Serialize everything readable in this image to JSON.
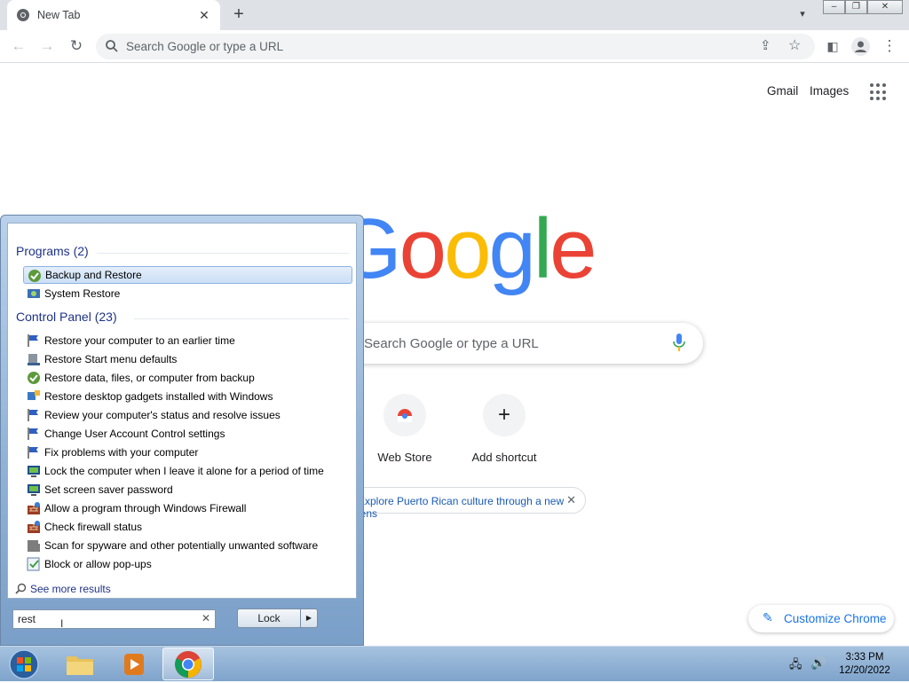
{
  "browser": {
    "tab_title": "New Tab",
    "omnibox_placeholder": "Search Google or type a URL"
  },
  "ntp": {
    "gmail": "Gmail",
    "images": "Images",
    "logo_letters": [
      "G",
      "o",
      "o",
      "g",
      "l",
      "e"
    ],
    "logo_colors": [
      "#4285f4",
      "#ea4335",
      "#fbbc05",
      "#4285f4",
      "#34a853",
      "#ea4335"
    ],
    "search_placeholder": "Search Google or type a URL",
    "shortcuts": [
      {
        "label": "Web Store",
        "icon": "web-store-icon"
      },
      {
        "label": "Add shortcut",
        "icon": "plus-icon",
        "glyph": "+"
      }
    ],
    "promo_chip": "Explore Puerto Rican culture through a new lens",
    "customize": "Customize Chrome"
  },
  "start_menu": {
    "programs_heading": "Programs (2)",
    "programs": [
      {
        "label": "Backup and Restore",
        "icon": "backup-restore-icon",
        "selected": true
      },
      {
        "label": "System Restore",
        "icon": "system-restore-icon"
      }
    ],
    "control_panel_heading": "Control Panel (23)",
    "control_panel": [
      {
        "label": "Restore your computer to an earlier time",
        "icon": "action-center-flag-icon"
      },
      {
        "label": "Restore Start menu defaults",
        "icon": "taskbar-icon"
      },
      {
        "label": "Restore data, files, or computer from backup",
        "icon": "backup-restore-icon"
      },
      {
        "label": "Restore desktop gadgets installed with Windows",
        "icon": "gadgets-icon"
      },
      {
        "label": "Review your computer's status and resolve issues",
        "icon": "action-center-flag-icon"
      },
      {
        "label": "Change User Account Control settings",
        "icon": "action-center-flag-icon"
      },
      {
        "label": "Fix problems with your computer",
        "icon": "action-center-flag-icon"
      },
      {
        "label": "Lock the computer when I leave it alone for a period of time",
        "icon": "display-icon"
      },
      {
        "label": "Set screen saver password",
        "icon": "display-icon"
      },
      {
        "label": "Allow a program through Windows Firewall",
        "icon": "firewall-icon"
      },
      {
        "label": "Check firewall status",
        "icon": "firewall-icon"
      },
      {
        "label": "Scan for spyware and other potentially unwanted software",
        "icon": "defender-icon"
      },
      {
        "label": "Block or allow pop-ups",
        "icon": "internet-options-icon"
      }
    ],
    "see_more": "See more results",
    "search_value": "rest",
    "lock_button": "Lock"
  },
  "taskbar": {
    "time": "3:33 PM",
    "date": "12/20/2022"
  }
}
